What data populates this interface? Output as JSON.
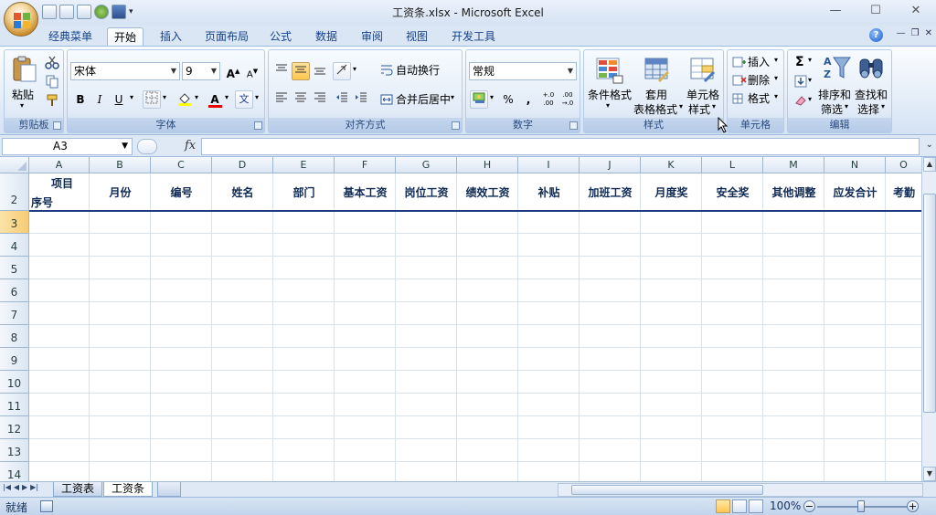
{
  "window": {
    "title": "工资条.xlsx - Microsoft Excel",
    "minimize": "—",
    "maximize": "☐",
    "close": "✕"
  },
  "ribbon_tabs": [
    "经典菜单",
    "开始",
    "插入",
    "页面布局",
    "公式",
    "数据",
    "审阅",
    "视图",
    "开发工具"
  ],
  "active_tab": "开始",
  "clipboard": {
    "title": "剪贴板",
    "paste": "粘贴"
  },
  "font": {
    "title": "字体",
    "name": "宋体",
    "size": "9",
    "bold": "B",
    "italic": "I",
    "underline": "U",
    "grow": "A",
    "shrink": "A",
    "fontcolor": "A",
    "phonetic": "文"
  },
  "alignment": {
    "title": "对齐方式",
    "wrap": "自动换行",
    "merge": "合并后居中"
  },
  "number": {
    "title": "数字",
    "format": "常规",
    "percent": "%",
    "comma": ",",
    "inc_dec": "+.0 .00",
    "dec_dec": ".00 →.0"
  },
  "styles": {
    "title": "样式",
    "conditional": "条件格式",
    "table_1": "套用",
    "table_2": "表格格式",
    "cell_1": "单元格",
    "cell_2": "样式"
  },
  "cells": {
    "title": "单元格",
    "insert": "插入",
    "delete": "删除",
    "format": "格式"
  },
  "editing": {
    "title": "编辑",
    "sigma": "Σ",
    "sort_1": "排序和",
    "sort_2": "筛选",
    "find_1": "查找和",
    "find_2": "选择"
  },
  "formula_bar": {
    "name_box": "A3",
    "fx": "fx",
    "value": ""
  },
  "columns": [
    "A",
    "B",
    "C",
    "D",
    "E",
    "F",
    "G",
    "H",
    "I",
    "J",
    "K",
    "L",
    "M",
    "N",
    "O"
  ],
  "rows": [
    "2",
    "3",
    "4",
    "5",
    "6",
    "7",
    "8",
    "9",
    "10",
    "11",
    "12",
    "13",
    "14"
  ],
  "header_row": {
    "a_top": "项目",
    "a_bottom": "序号",
    "cells": [
      "月份",
      "编号",
      "姓名",
      "部门",
      "基本工资",
      "岗位工资",
      "绩效工资",
      "补贴",
      "加班工资",
      "月度奖",
      "安全奖",
      "其他调整",
      "应发合计",
      "考勤"
    ]
  },
  "sheets": [
    "工资表",
    "工资条"
  ],
  "active_sheet": "工资条",
  "status": {
    "ready": "就绪",
    "zoom": "100%",
    "minus": "−",
    "plus": "+"
  },
  "colors": {
    "accent": "#15428b",
    "header_text": "#0e2a55",
    "selected_row": "#f8cb74"
  }
}
